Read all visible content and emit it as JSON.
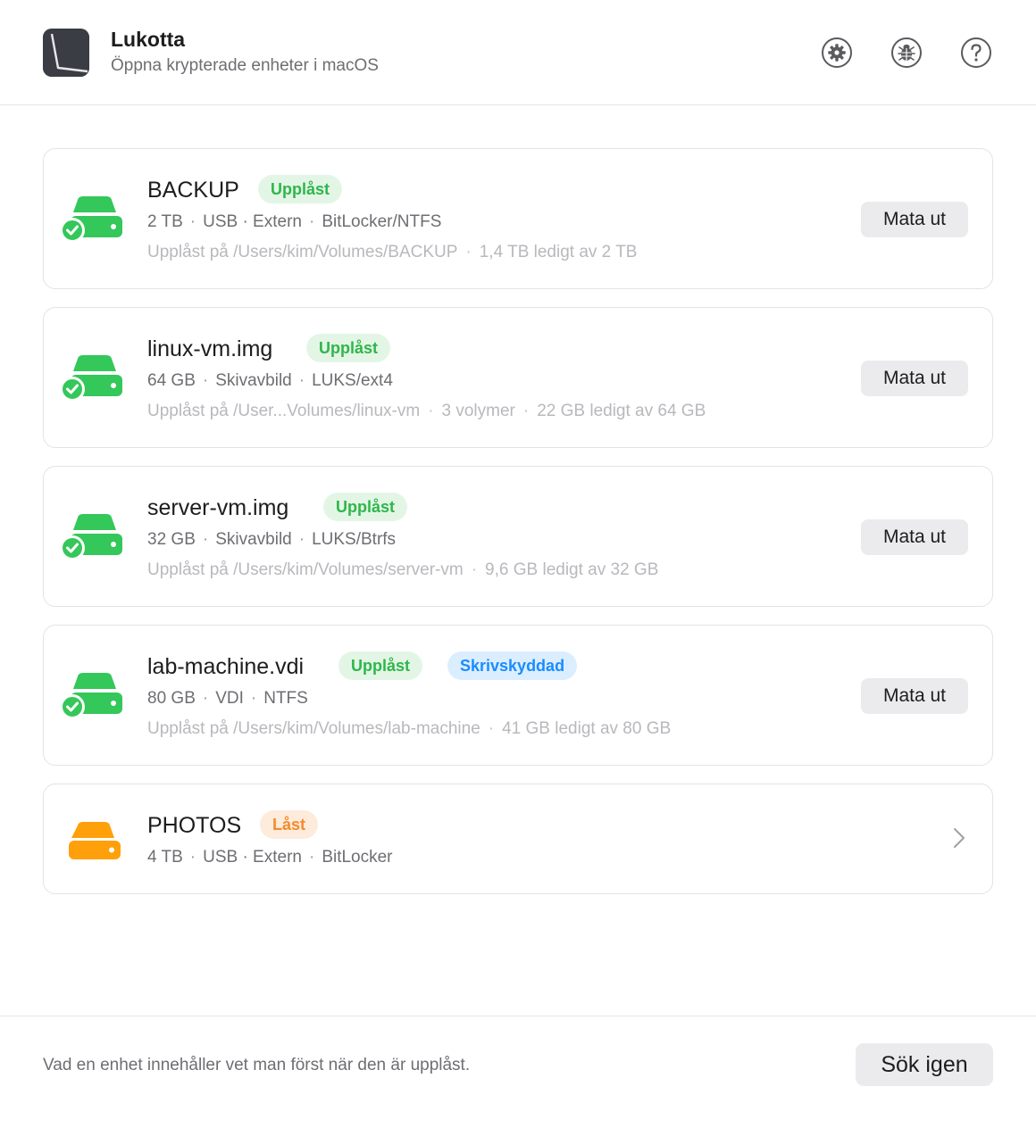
{
  "app": {
    "title": "Lukotta",
    "subtitle": "Öppna krypterade enheter i macOS",
    "icon": "app-logo-icon"
  },
  "toolbar": {
    "buttons": [
      {
        "icon": "gear-icon"
      },
      {
        "icon": "bug-icon"
      },
      {
        "icon": "help-icon"
      }
    ]
  },
  "colors": {
    "unlocked": "#34c759",
    "locked": "#ff9f0a",
    "badge_green_text": "#2fb64a",
    "badge_blue_text": "#1a8cff",
    "badge_orange_text": "#f58a2c"
  },
  "separator": "·",
  "devices": [
    {
      "name": "BACKUP",
      "status": "unlocked",
      "badges": [
        "Upplåst"
      ],
      "meta": [
        "2 TB",
        "USB · Extern",
        "BitLocker/NTFS"
      ],
      "details": [
        "Upplåst på /Users/kim/Volumes/BACKUP",
        "1,4 TB ledigt av 2 TB"
      ],
      "action": "Mata ut"
    },
    {
      "name": "linux-vm.img",
      "status": "unlocked",
      "badges": [
        "Upplåst"
      ],
      "meta": [
        "64 GB",
        "Skivavbild",
        "LUKS/ext4"
      ],
      "details": [
        "Upplåst på /User...Volumes/linux-vm",
        "3 volymer",
        "22 GB ledigt av 64 GB"
      ],
      "action": "Mata ut"
    },
    {
      "name": "server-vm.img",
      "status": "unlocked",
      "badges": [
        "Upplåst"
      ],
      "meta": [
        "32 GB",
        "Skivavbild",
        "LUKS/Btrfs"
      ],
      "details": [
        "Upplåst på /Users/kim/Volumes/server-vm",
        "9,6 GB ledigt av 32 GB"
      ],
      "action": "Mata ut"
    },
    {
      "name": "lab-machine.vdi",
      "status": "unlocked",
      "badges": [
        "Upplåst",
        "Skrivskyddad"
      ],
      "meta": [
        "80 GB",
        "VDI",
        "NTFS"
      ],
      "details": [
        "Upplåst på /Users/kim/Volumes/lab-machine",
        "41 GB ledigt av 80 GB"
      ],
      "action": "Mata ut"
    },
    {
      "name": "PHOTOS",
      "status": "locked",
      "badges": [
        "Låst"
      ],
      "meta": [
        "4 TB",
        "USB · Extern",
        "BitLocker"
      ],
      "details": [],
      "action": null
    }
  ],
  "footer": {
    "note": "Vad en enhet innehåller vet man först när den är upplåst.",
    "rescan_label": "Sök igen"
  }
}
